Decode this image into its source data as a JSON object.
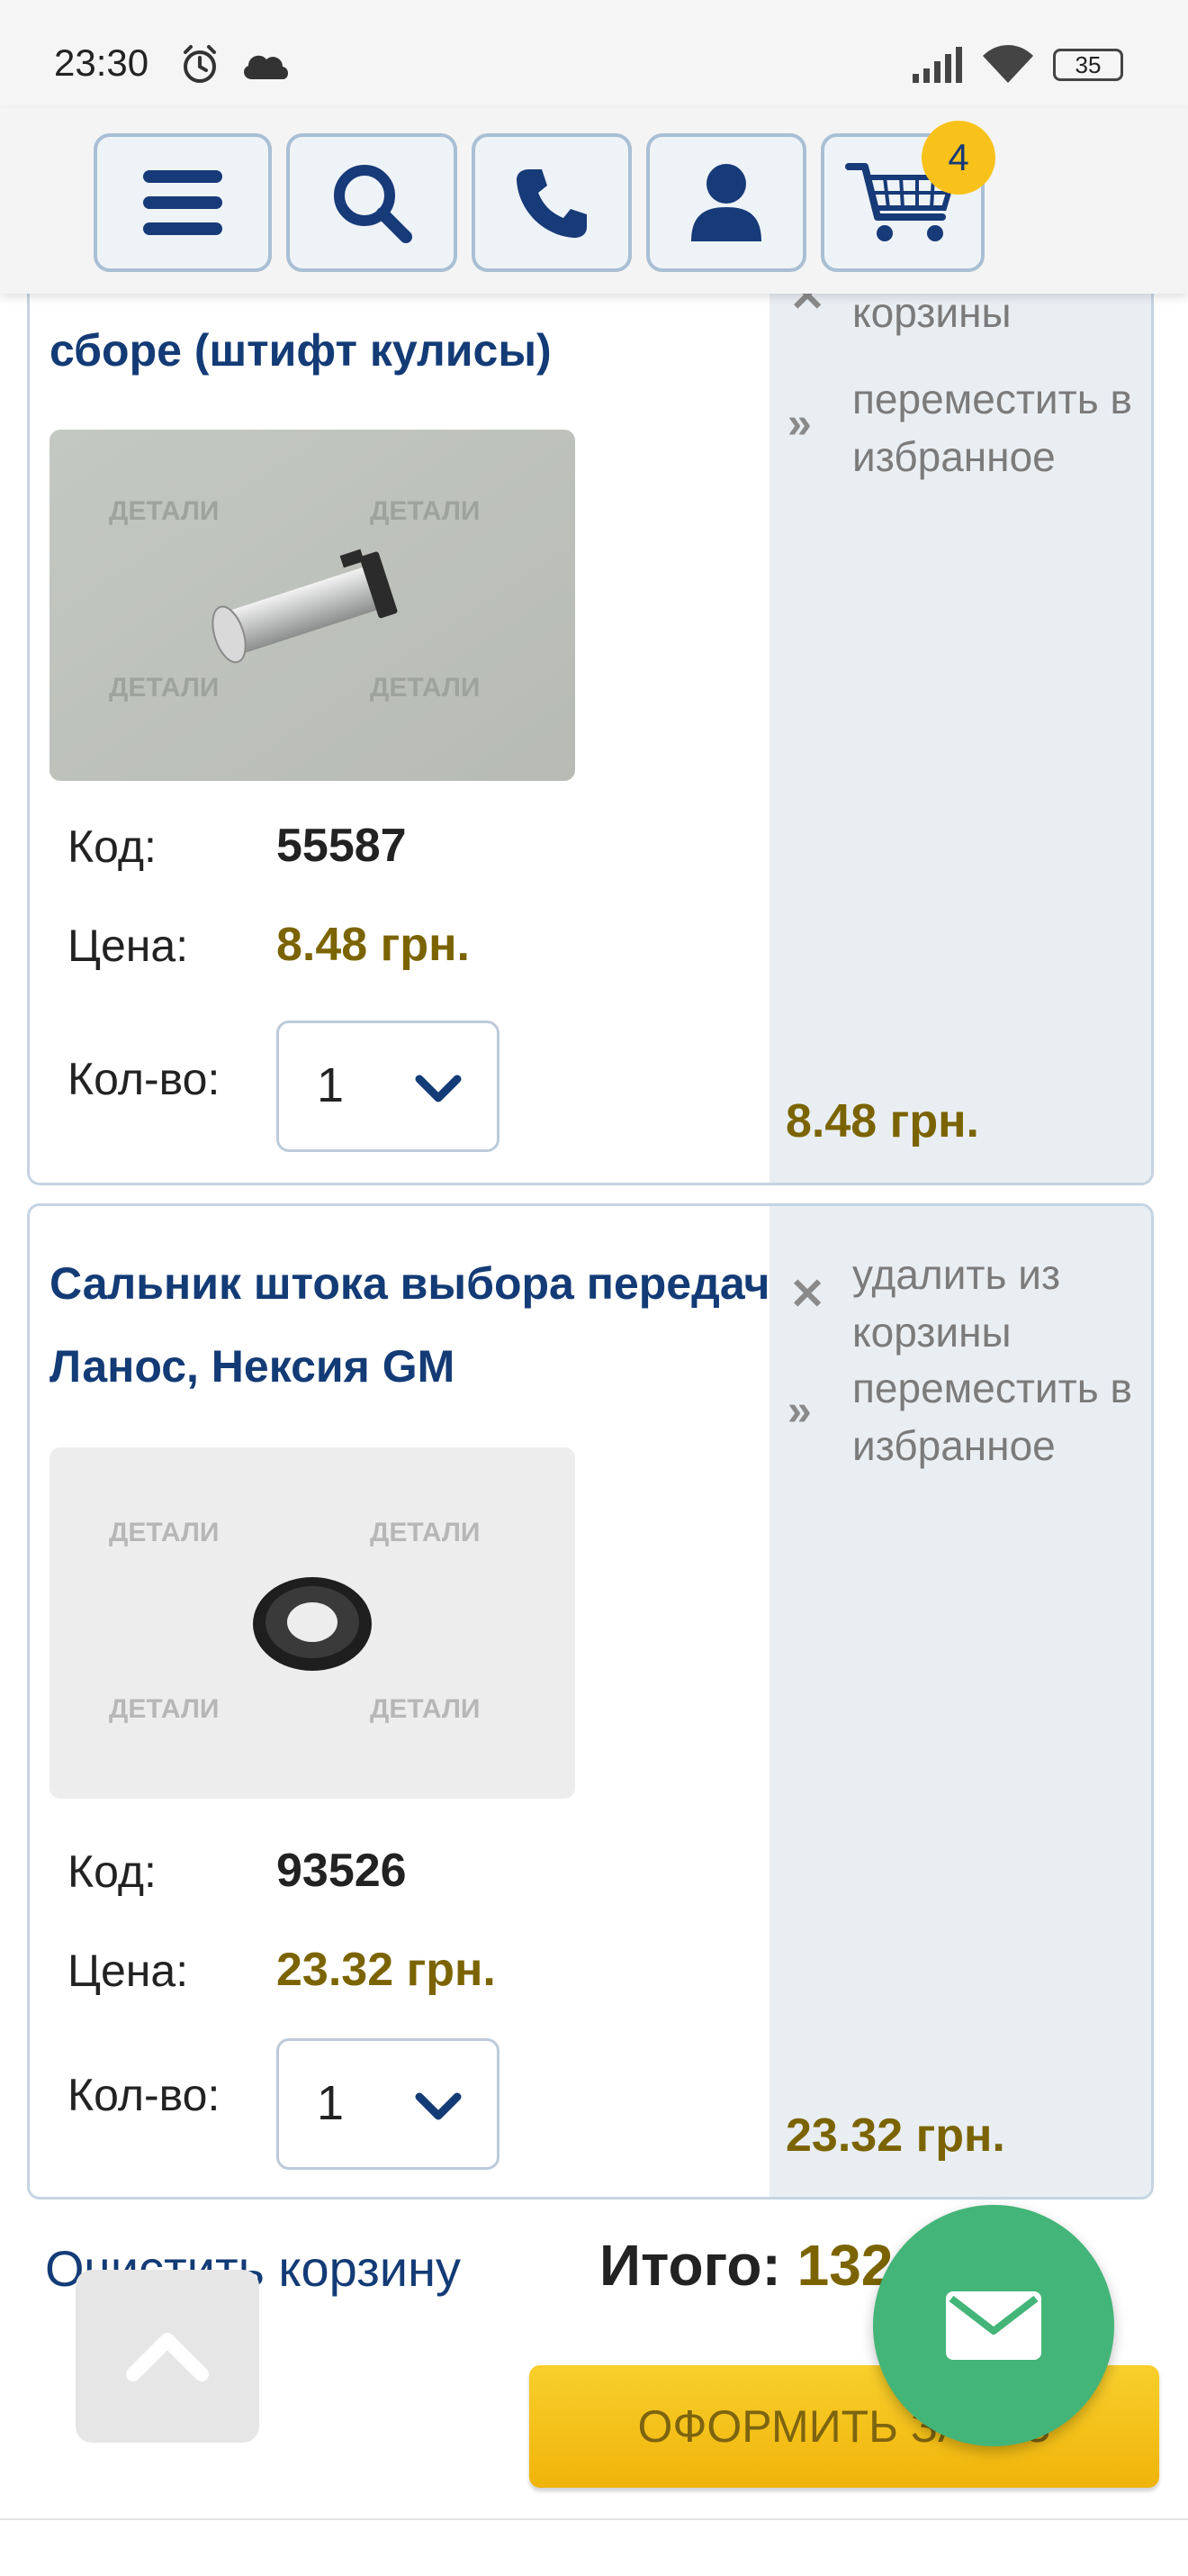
{
  "status_bar": {
    "time": "23:30",
    "battery": "35",
    "icons": [
      "alarm-icon",
      "cloud-icon",
      "signal-icon",
      "wifi-icon",
      "battery-icon"
    ]
  },
  "header": {
    "buttons": [
      "menu-icon",
      "search-icon",
      "phone-icon",
      "user-icon",
      "cart-icon"
    ],
    "cart_count": "4"
  },
  "colors": {
    "brand_blue": "#133b76",
    "price": "#7b6400",
    "checkout_yellow": "#f5c01a",
    "fab_green": "#44b578"
  },
  "items": [
    {
      "title_visible": "сборе (штифт кулисы)",
      "code_label": "Код:",
      "code": "55587",
      "price_label": "Цена:",
      "price": "8.48 грн.",
      "qty_label": "Кол-во:",
      "qty": "1",
      "remove_label_partial": "корзины",
      "move_label": "переместить в избранное",
      "sum": "8.48 грн.",
      "watermark": "ДЕТАЛИ"
    },
    {
      "title": "Сальник штока выбора передач Ланос, Нексия GM",
      "code_label": "Код:",
      "code": "93526",
      "price_label": "Цена:",
      "price": "23.32 грн.",
      "qty_label": "Кол-во:",
      "qty": "1",
      "remove_label": "удалить из корзины",
      "move_label": "переместить в избранное",
      "sum": "23.32 грн.",
      "watermark": "ДЕТАЛИ"
    }
  ],
  "footer": {
    "clear_label": "Очистить корзину",
    "total_label": "Итого:",
    "total_value_partial": "132",
    "checkout_label": "ОФОРМИТЬ ЗАКАЗ"
  }
}
